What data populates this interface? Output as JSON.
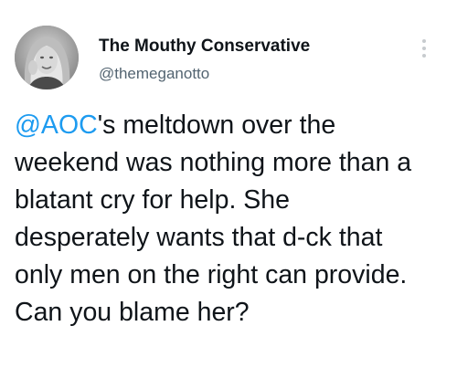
{
  "author": {
    "display_name": "The Mouthy Conservative",
    "handle": "@themeganotto",
    "avatar_icon": "profile-photo-avatar"
  },
  "menu": {
    "icon": "more-options-icon"
  },
  "tweet": {
    "mention": "@AOC",
    "text_after_mention": "'s meltdown over the\nweekend was nothing more than a\nblatant cry for help. She\ndesperately wants that d-ck that\nonly men on the right can provide.\nCan you blame her?"
  },
  "colors": {
    "mention": "#1d9bf0",
    "text": "#0f1419",
    "secondary": "#536471",
    "dots": "#c7cbce"
  }
}
